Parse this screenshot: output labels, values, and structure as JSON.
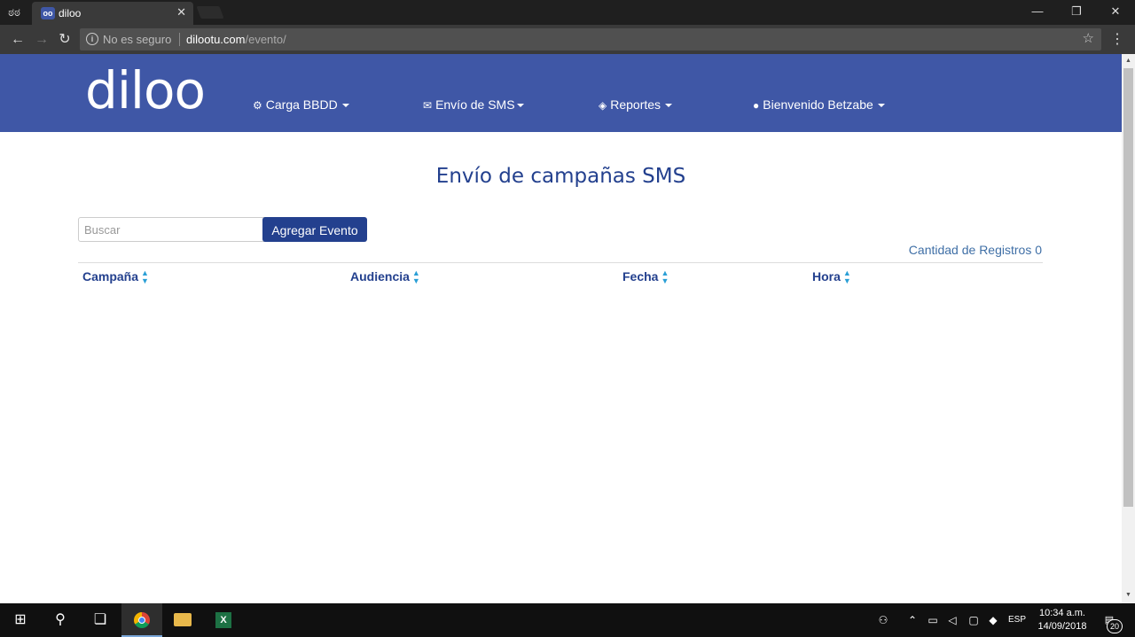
{
  "browser": {
    "tab_title": "diloo",
    "tab_favicon": "oo",
    "security_text": "No es seguro",
    "url_host": "dilootu.com",
    "url_path": "/evento/"
  },
  "app": {
    "logo": "diloo",
    "brand_color": "#3f57a6",
    "nav": [
      {
        "label": "Carga BBDD",
        "icon": "gear-icon"
      },
      {
        "label": "Envío de SMS",
        "icon": "envelope-icon"
      },
      {
        "label": "Reportes",
        "icon": "cube-icon"
      },
      {
        "label": "Bienvenido Betzabe",
        "icon": "user-icon"
      }
    ]
  },
  "main": {
    "title": "Envío de campañas SMS",
    "search_placeholder": "Buscar",
    "add_button": "Agregar Evento",
    "record_count": "Cantidad de Registros 0",
    "columns": [
      "Campaña",
      "Audiencia",
      "Fecha",
      "Hora"
    ]
  },
  "taskbar": {
    "language": "ESP",
    "time": "10:34 a.m.",
    "date": "14/09/2018",
    "notifications": "20"
  }
}
